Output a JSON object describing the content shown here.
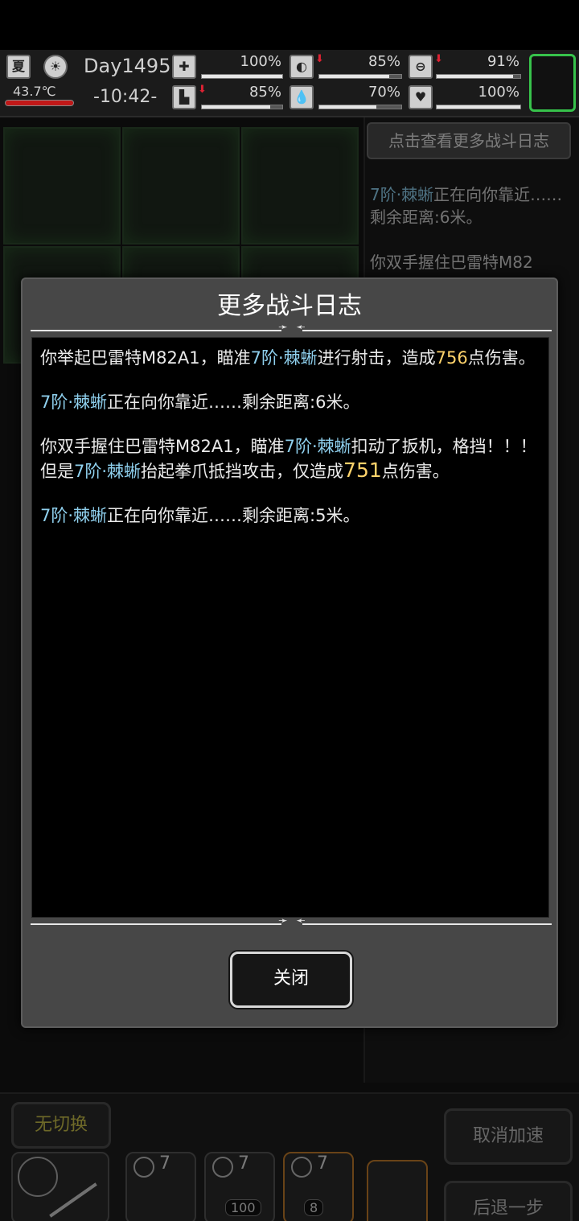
{
  "status": {
    "season": "夏",
    "temperature": "43.7℃",
    "day": "Day1495",
    "time": "-10:42-",
    "stats": [
      {
        "icon": "medkit-icon",
        "value": "100%",
        "level": 1.0
      },
      {
        "icon": "stomach-icon",
        "value": "85%",
        "level": 0.85
      },
      {
        "icon": "lung-icon",
        "value": "91%",
        "level": 0.91
      },
      {
        "icon": "boot-icon",
        "value": "85%",
        "level": 0.85
      },
      {
        "icon": "water-drop-icon",
        "value": "70%",
        "level": 0.7
      },
      {
        "icon": "heart-icon",
        "value": "100%",
        "level": 1.0
      }
    ]
  },
  "background_log": {
    "button": "点击查看更多战斗日志",
    "entries": [
      {
        "pre": "7阶·",
        "enemy": "",
        "text": "7阶·",
        "tail": "正在向你靠近……剩余距离:6米。"
      },
      {
        "text": "你双手握住巴雷特M82"
      }
    ]
  },
  "bottom": {
    "switch_label": "无切换",
    "cancel_speed": "取消加速",
    "step_back": "后退一步",
    "slots": [
      {
        "count": "7",
        "ammo": ""
      },
      {
        "count": "7",
        "ammo": "100"
      },
      {
        "count": "7",
        "ammo": "8"
      }
    ]
  },
  "modal": {
    "title": "更多战斗日志",
    "close": "关闭",
    "enemy_name": "7阶·棘蜥",
    "entries": [
      {
        "p1": "你举起巴雷特M82A1，瞄准",
        "enemy": "7阶·棘蜥",
        "p2": "进行射击，造成",
        "dmg": "756",
        "p3": "点伤害。"
      },
      {
        "enemy": "7阶·棘蜥",
        "p2": "正在向你靠近……剩余距离:6米。"
      },
      {
        "p1": "你双手握住巴雷特M82A1，瞄准",
        "enemy": "7阶·棘蜥",
        "p2": "扣动了扳机，格挡！！！但是",
        "enemy2": "7阶·棘蜥",
        "p3": "抬起拳爪抵挡攻击，仅造成",
        "dmg": "751",
        "p4": "点伤害。"
      },
      {
        "enemy": "7阶·棘蜥",
        "p2": "正在向你靠近……剩余距离:5米。"
      }
    ]
  }
}
